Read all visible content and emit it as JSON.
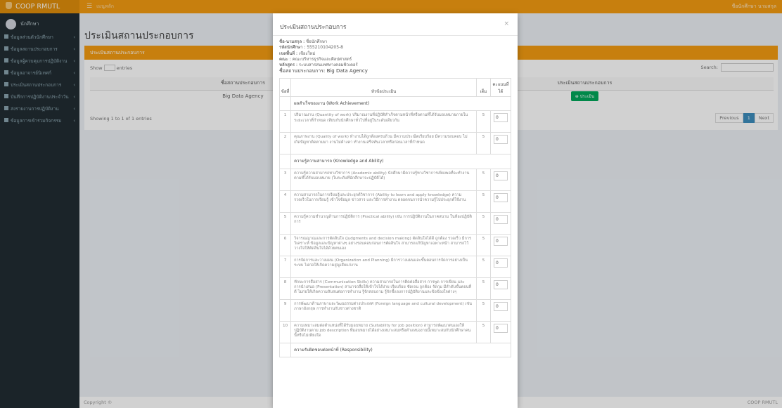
{
  "app": {
    "brand": "COOP RMUTL",
    "toggle_label": "เมนูหลัก",
    "user_menu": "ชื่อนักศึกษา นามสกุล"
  },
  "sidebar": {
    "user": "นักศึกษา",
    "items": [
      {
        "label": "ข้อมูลส่วนตัวนักศึกษา"
      },
      {
        "label": "ข้อมูลสถานประกอบการ"
      },
      {
        "label": "ข้อมูลผู้ควบคุมการปฏิบัติงาน"
      },
      {
        "label": "ข้อมูลอาจารย์นิเทศก์"
      },
      {
        "label": "ประเมินสถานประกอบการ"
      },
      {
        "label": "บันทึกการปฏิบัติงานประจำวัน"
      },
      {
        "label": "ส่งรายงานการปฏิบัติงาน"
      },
      {
        "label": "ข้อมูลการเข้าร่วมกิจกรรม"
      }
    ]
  },
  "page": {
    "title": "ประเมินสถานประกอบการ"
  },
  "box": {
    "header": "ประเมินสถานประกอบการ",
    "show": "Show",
    "entries": "entries",
    "page_size": "10",
    "search_label": "Search:",
    "columns": [
      "ชื่อสถานประกอบการ",
      "ประเมินสถานประกอบการ"
    ],
    "rows": [
      {
        "name": "Big Data Agency",
        "action": "ประเมิน"
      }
    ],
    "showing": "Showing 1 to 1 of 1 entries",
    "pager": {
      "prev": "Previous",
      "page": "1",
      "next": "Next"
    }
  },
  "footer": {
    "left": "Copyright ©",
    "right": "COOP RMUTL"
  },
  "modal": {
    "title": "ประเมินสถานประกอบการ",
    "close": "×",
    "info": [
      {
        "k": "ชื่อ-นามสกุล :",
        "v": "ชื่อนักศึกษา"
      },
      {
        "k": "รหัสนักศึกษา :",
        "v": "555210104205-8"
      },
      {
        "k": "เขตพื้นที่ :",
        "v": "เชียงใหม่"
      },
      {
        "k": "คณะ :",
        "v": "คณะบริหารธุรกิจและศิลปศาสตร์"
      },
      {
        "k": "หลักสูตร :",
        "v": "ระบบสารสนเทศทางคอมพิวเตอร์"
      }
    ],
    "company_label": "ชื่อสถานประกอบการ:",
    "company": "Big Data Agency",
    "table_head": {
      "no": "ข้อที่",
      "item": "หัวข้อประเมิน",
      "full": "เต็ม",
      "score": "คะแนนที่ได้"
    },
    "rows": [
      {
        "type": "section",
        "text": "ผลสำเร็จของงาน (Work Achievement)"
      },
      {
        "no": "1",
        "text": "ปริมาณงาน (Quantity of work) ปริมาณงานที่ปฏิบัติสำเร็จตามหน้าที่หรือตามที่ได้รับมอบหมายภายในระยะเวลาที่กำหนด เทียบกับนักศึกษาทั่วไปที่อยู่ในระดับเดียวกัน",
        "full": "5",
        "score": "0"
      },
      {
        "no": "2",
        "text": "คุณภาพงาน (Quality of work) ทำงานได้ถูกต้องครบถ้วน มีความประณีตเรียบร้อย มีความรอบคอบ ไม่เกิดปัญหาติดตามมา งานไม่ค้างคา ทำงานเสร็จทันเวลาหรือก่อนเวลาที่กำหนด",
        "full": "5",
        "score": "0"
      },
      {
        "type": "section",
        "text": "ความรู้ความสามารถ (Knowledge and Ability)"
      },
      {
        "no": "3",
        "text": "ความรู้ความสามารถทางวิชาการ (Academic ability) นักศึกษามีความรู้ทางวิชาการเพียงพอที่จะทำงานตามที่ได้รับมอบหมาย (ในระดับที่นักศึกษาจะปฏิบัติได้)",
        "full": "5",
        "score": "0"
      },
      {
        "no": "4",
        "text": "ความสามารถในการเรียนรู้และประยุกต์วิชาการ (Ability to learn and apply knowledge) ความรวดเร็วในการเรียนรู้ เข้าใจข้อมูล ข่าวสาร และวิธีการทำงาน ตลอดจนการนำความรู้ไปประยุกต์ใช้งาน",
        "full": "5",
        "score": "0"
      },
      {
        "no": "5",
        "text": "ความรู้ความชำนาญด้านการปฏิบัติการ (Practical ability) เช่น การปฏิบัติงานในภาคสนาม ในห้องปฏิบัติการ",
        "full": "5",
        "score": "0"
      },
      {
        "no": "6",
        "text": "วิจารณญาณและการตัดสินใจ (Judgments and decision making) ตัดสินใจได้ดี ถูกต้อง รวดเร็ว มีการวิเคราะห์ ข้อมูลและปัญหาต่างๆ อย่างรอบคอบก่อนการตัดสินใจ สามารถแก้ปัญหาเฉพาะหน้า สามารถไว้วางใจให้ตัดสินใจได้ด้วยตนเอง",
        "full": "5",
        "score": "0"
      },
      {
        "no": "7",
        "text": "การจัดการและวางแผน (Organization and Planning) มีการวางแผนและขั้นตอนการจัดการอย่างเป็นระบบ ไม่ก่อให้เกิดความสูญเสียแก่งาน",
        "full": "5",
        "score": "0"
      },
      {
        "no": "8",
        "text": "ทักษะการสื่อสาร (Communication Skills) ความสามารถในการติดต่อสื่อสาร การพูด การเขียน และการนำเสนอ (Presentation) สามารถสื่อให้เข้าใจได้ง่าย เรียบร้อย ชัดเจน ถูกต้อง รัดกุม มีลำดับขั้นตอนที่ดี ไม่ก่อให้เกิดความสับสนต่อการทำงาน รู้จักสอบถาม รู้จักชี้แจงการปฏิบัติงานและข้อข้องใจต่างๆ",
        "full": "5",
        "score": "0"
      },
      {
        "no": "9",
        "text": "การพัฒนาด้านภาษาและวัฒนธรรมต่างประเทศ (Foreign language and cultural development) เช่น ภาษาอังกฤษ การทำงานกับชาวต่างชาติ",
        "full": "5",
        "score": "0"
      },
      {
        "no": "10",
        "text": "ความเหมาะสมต่อตำแหน่งที่ได้รับมอบหมาย (Suitability for job position) สามารถพัฒนาตนเองให้ปฏิบัติงานตาม job description ที่มอบหมายได้อย่างเหมาะสมหรือตำแหน่งงานนี้เหมาะสมกับนักศึกษาคนนี้หรือไม่เพียงใด",
        "full": "5",
        "score": "0"
      },
      {
        "type": "section",
        "text": "ความรับผิดชอบต่อหน้าที่ (Responsibility)"
      }
    ]
  }
}
